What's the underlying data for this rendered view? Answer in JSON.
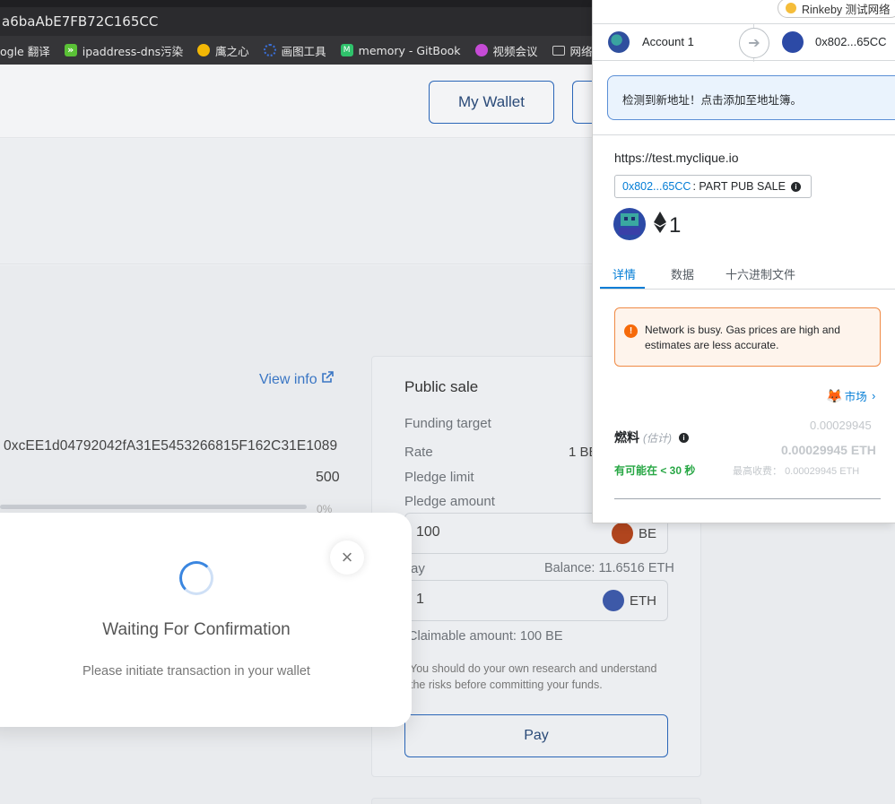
{
  "browser": {
    "url_fragment": "a6baAbE7FB72C165CC",
    "bookmarks": [
      {
        "label": "ogle 翻译",
        "icon": "translate-icon",
        "color": "#5a8de8"
      },
      {
        "label": "ipaddress-dns污染",
        "icon": "double-arrow-icon",
        "color": "#5ac136"
      },
      {
        "label": "鹰之心",
        "icon": "bird-icon",
        "color": "#f2b705"
      },
      {
        "label": "画图工具",
        "icon": "drawio-icon",
        "color": "#3a6fd8"
      },
      {
        "label": "memory - GitBook",
        "icon": "gitbook-icon",
        "color": "#2fc26b"
      },
      {
        "label": "视频会议",
        "icon": "video-icon",
        "color": "#c64bd6"
      },
      {
        "label": "网络",
        "icon": "folder-icon",
        "color": "#bbbbbb"
      }
    ]
  },
  "header": {
    "wallet_button": "My Wallet"
  },
  "project": {
    "view_info": "View info",
    "address": "0xcEE1d04792042fA31E5453266815F162C31E1089",
    "value": "500",
    "percent": "0%",
    "progress": 0
  },
  "sale": {
    "title": "Public sale",
    "funding_target_label": "Funding target",
    "rate_label": "Rate",
    "rate_value": "1 BE",
    "pledge_limit_label": "Pledge limit",
    "pledge_amount_label": "Pledge amount",
    "pledge_amount_value": "100",
    "pledge_token": "BE",
    "pay_label": "ay",
    "balance": "Balance: 11.6516 ETH",
    "pay_amount_value": "1",
    "pay_token": "ETH",
    "claimable": "Claimable amount: 100 BE",
    "disclaimer": "You should do your own research and understand the risks before committing your funds.",
    "pay_button": "Pay"
  },
  "modal": {
    "title": "Waiting For Confirmation",
    "subtitle": "Please initiate transaction in your wallet",
    "close": "×"
  },
  "metamask": {
    "network": "Rinkeby 测试网络",
    "network_color": "#f5bd3a",
    "from_account": "Account 1",
    "to_account": "0x802...65CC",
    "notice": "检测到新地址！点击添加至地址簿。",
    "origin": "https://test.myclique.io",
    "contract_address": "0x802...65CC",
    "contract_function": ": PART PUB SALE",
    "eth_value": "1",
    "tabs": [
      "详情",
      "数据",
      "十六进制文件"
    ],
    "warning": "Network is busy. Gas prices are high and estimates are less accurate.",
    "market_label": "市场",
    "gas_label": "燃料",
    "gas_estimate_label": "(估计)",
    "gas_value_top": "0.00029945",
    "gas_value_eth": "0.00029945 ETH",
    "likely_text": "有可能在 < 30 秒",
    "max_fee_label": "最高收费：",
    "max_fee_value": "0.00029945 ETH",
    "accent": "#037dd6"
  }
}
